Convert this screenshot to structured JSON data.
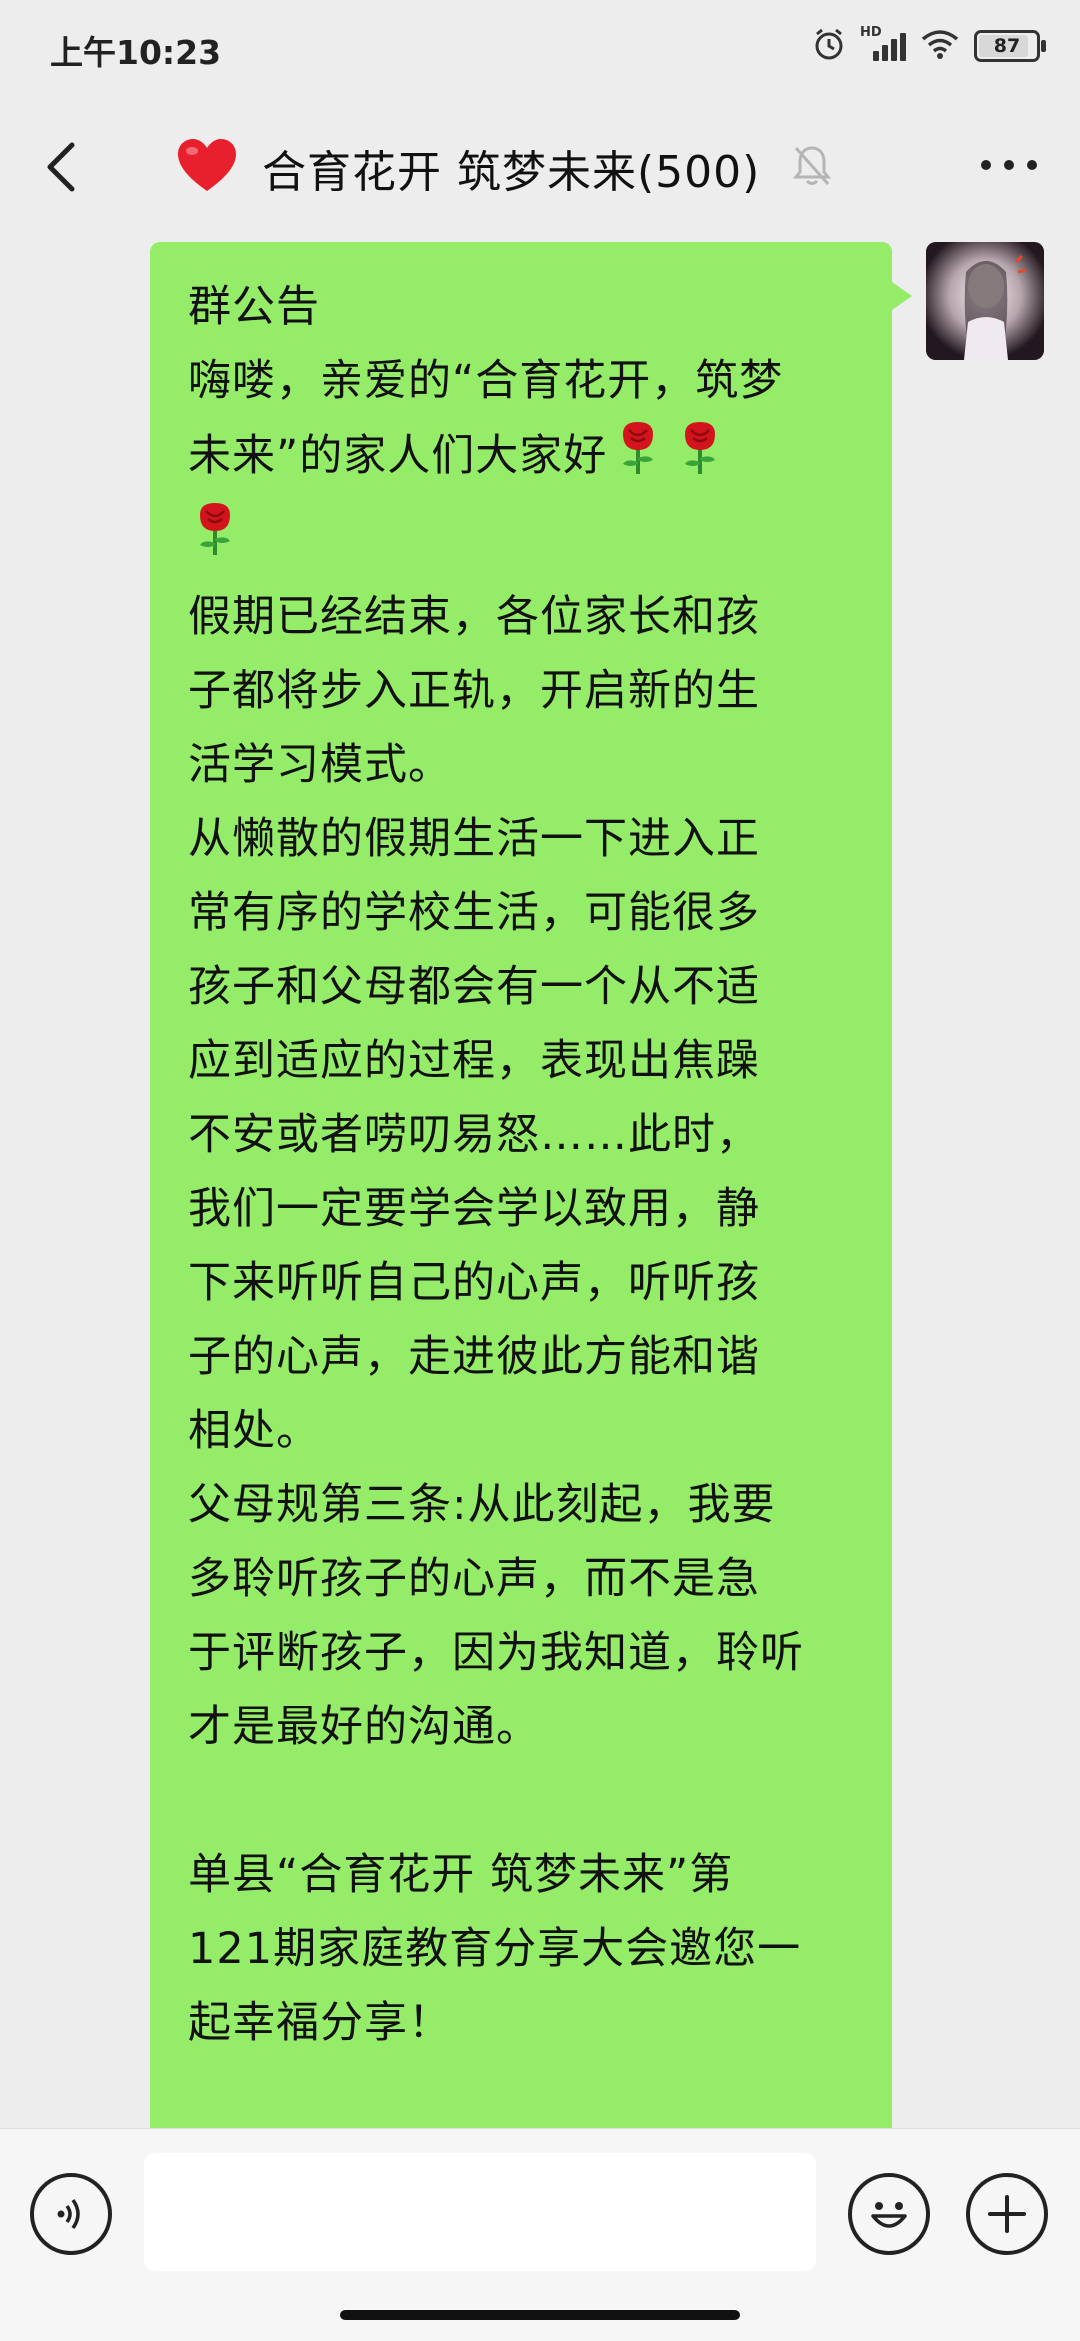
{
  "status_bar": {
    "time": "上午10:23",
    "network_label": "HD",
    "battery_level": "87"
  },
  "header": {
    "emoji": "❤️",
    "title": "合育花开 筑梦未来(500)",
    "icons": [
      "back-icon",
      "mute-bell-icon",
      "more-icon"
    ]
  },
  "message": {
    "lines": [
      "群公告",
      "嗨喽，亲爱的“合育花开，筑梦",
      "未来”的家人们大家好",
      "",
      "假期已经结束，各位家长和孩",
      "子都将步入正轨，开启新的生",
      "活学习模式。",
      "从懒散的假期生活一下进入正",
      "常有序的学校生活，可能很多",
      "孩子和父母都会有一个从不适",
      "应到适应的过程，表现出焦躁",
      "不安或者唠叨易怒……此时，",
      "我们一定要学会学以致用，静",
      "下来听听自己的心声，听听孩",
      "子的心声，走进彼此方能和谐",
      "相处。",
      "父母规第三条:从此刻起，我要",
      "多聆听孩子的心声，而不是急",
      "于评断孩子，因为我知道，聆听",
      "才是最好的沟通。",
      "单县“合育花开  筑梦未来”第",
      "121期家庭教育分享大会邀您一",
      "起幸福分享！"
    ],
    "rose_emoji": "🌹",
    "bubble_color": "#95ec69"
  },
  "input_bar": {
    "placeholder": "",
    "icons": [
      "voice-icon",
      "emoji-icon",
      "plus-icon"
    ]
  }
}
